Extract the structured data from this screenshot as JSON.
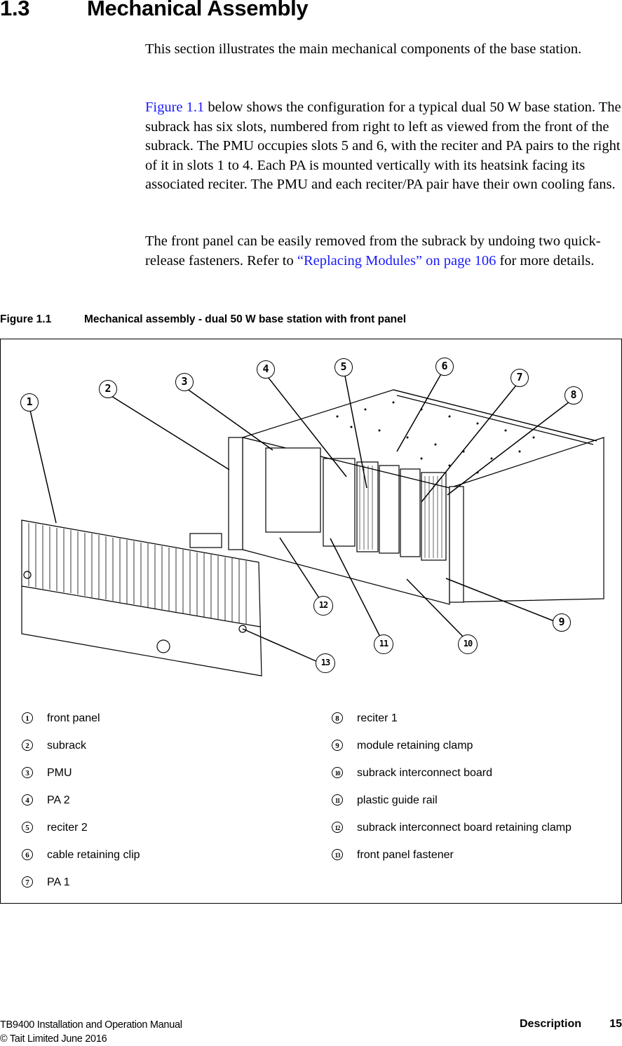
{
  "section": {
    "number": "1.3",
    "title": "Mechanical Assembly"
  },
  "paragraphs": {
    "p1": "This section illustrates the main mechanical components of the base station.",
    "p2_link": "Figure 1.1",
    "p2_rest": " below shows the configuration for a typical dual 50 W base station. The subrack has six slots, numbered from right to left as viewed from the front of the subrack. The PMU occupies slots 5 and 6, with the reciter and PA pairs to the right of it in slots 1 to 4. Each PA is mounted vertically with its heatsink facing its associated reciter. The PMU and each reciter/PA pair have their own cooling fans.",
    "p3_before": "The front panel can be easily removed from the subrack by undoing two quick-release fasteners. Refer to ",
    "p3_link": "“Replacing Modules” on page 106",
    "p3_after": " for more details."
  },
  "figure": {
    "number": "Figure 1.1",
    "caption": "Mechanical assembly - dual 50 W base station with front panel",
    "callouts": [
      "1",
      "2",
      "3",
      "4",
      "5",
      "6",
      "7",
      "8",
      "9",
      "10",
      "11",
      "12",
      "13"
    ],
    "legend": [
      {
        "num": "1",
        "label": "front panel"
      },
      {
        "num": "2",
        "label": "subrack"
      },
      {
        "num": "3",
        "label": "PMU"
      },
      {
        "num": "4",
        "label": "PA 2"
      },
      {
        "num": "5",
        "label": "reciter 2"
      },
      {
        "num": "6",
        "label": "cable retaining clip"
      },
      {
        "num": "7",
        "label": "PA 1"
      },
      {
        "num": "8",
        "label": "reciter 1"
      },
      {
        "num": "9",
        "label": "module retaining clamp"
      },
      {
        "num": "10",
        "label": "subrack interconnect board"
      },
      {
        "num": "11",
        "label": "plastic guide rail"
      },
      {
        "num": "12",
        "label": "subrack interconnect board retaining clamp"
      },
      {
        "num": "13",
        "label": "front panel fastener"
      }
    ]
  },
  "footer": {
    "manual": "TB9400 Installation and Operation Manual",
    "copyright": "© Tait Limited June 2016",
    "chapter": "Description",
    "page": "15"
  },
  "colors": {
    "link": "#1a1aff"
  }
}
